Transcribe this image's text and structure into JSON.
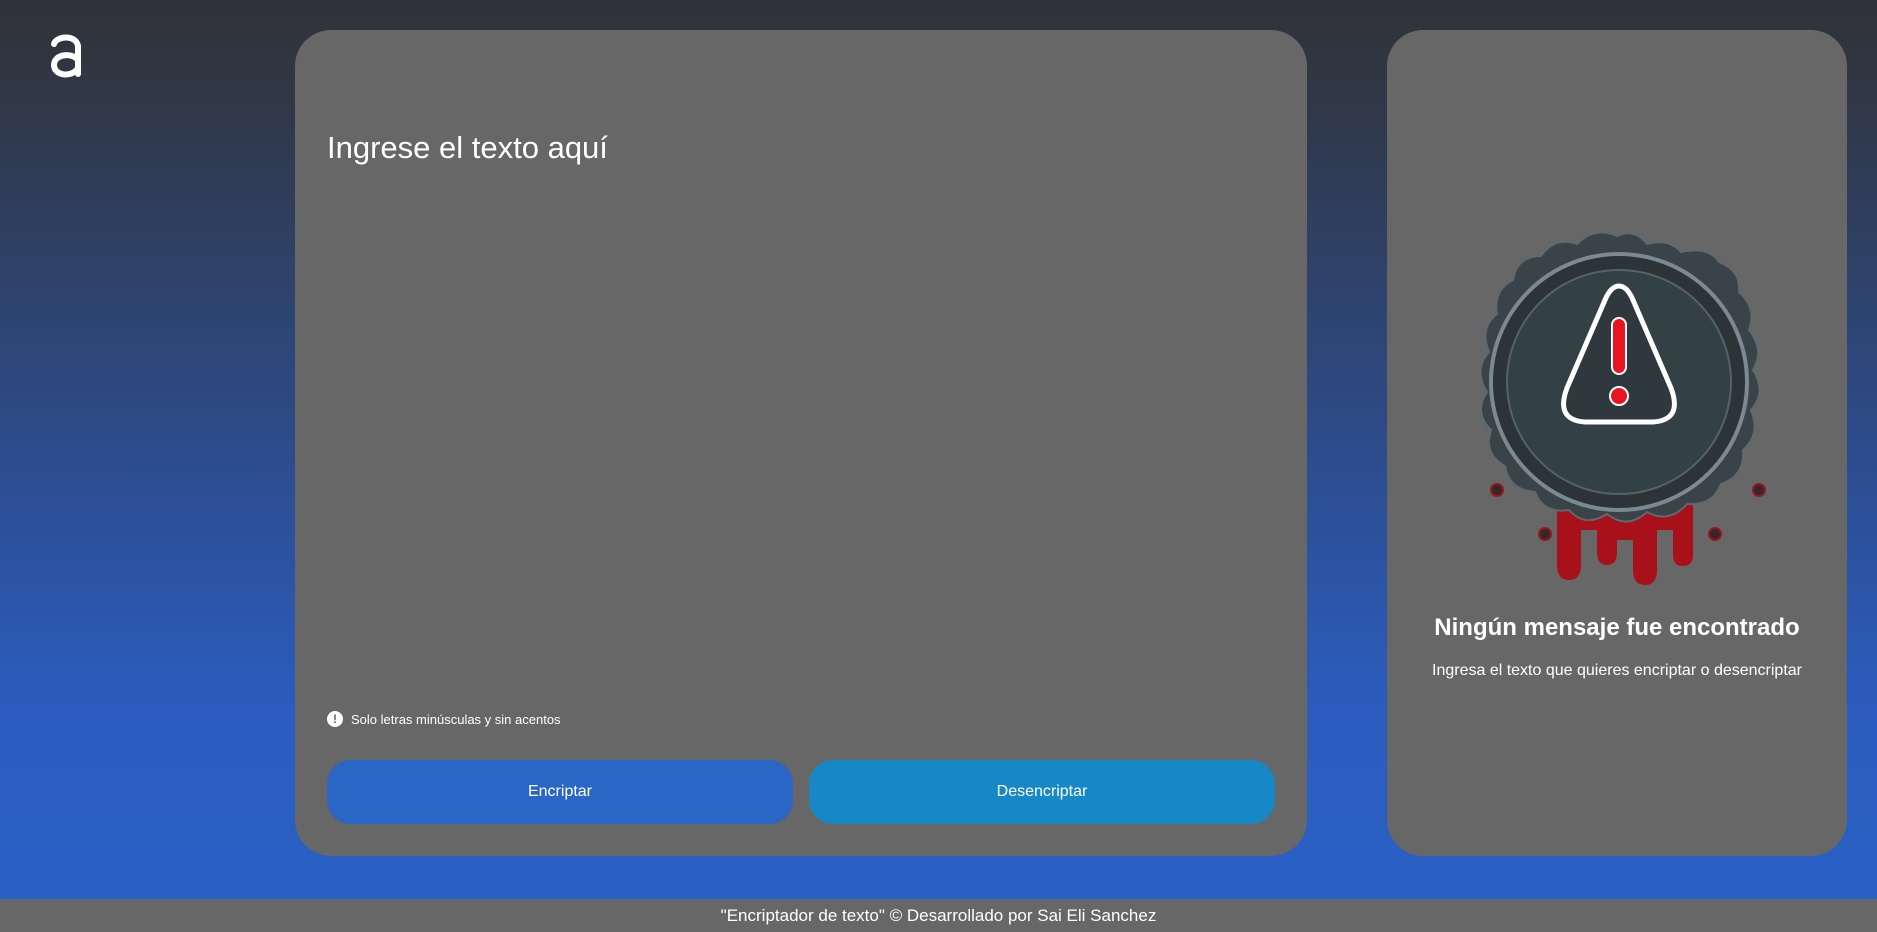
{
  "logo": {
    "icon": "alura-a-icon"
  },
  "input": {
    "placeholder": "Ingrese el texto aquí",
    "value": "",
    "hint_icon": "exclamation-circle-icon",
    "hint": "Solo letras minúsculas y sin acentos"
  },
  "buttons": {
    "encrypt_label": "Encriptar",
    "decrypt_label": "Desencriptar"
  },
  "output": {
    "image": "warning-badge-icon",
    "title": "Ningún mensaje fue encontrado",
    "subtitle": "Ingresa el texto que quieres encriptar o desencriptar"
  },
  "footer": {
    "text": "\"Encriptador de texto\" © Desarrollado por Sai Eli Sanchez"
  },
  "colors": {
    "panel": "#676767",
    "encrypt_button": "#2a66c6",
    "decrypt_button": "#1788c6",
    "background_top": "#303236",
    "background_bottom": "#2a61c6"
  }
}
